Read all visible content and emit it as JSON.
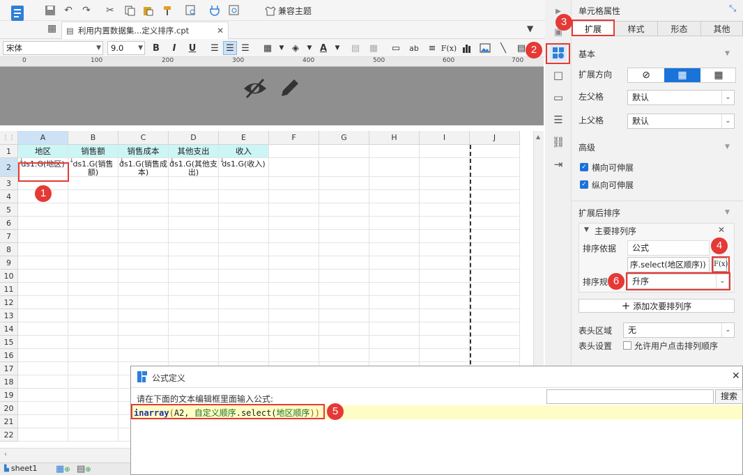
{
  "toolbar": {
    "theme_label": "兼容主题"
  },
  "file_tab": {
    "name": "利用内置数据集...定义排序.cpt"
  },
  "format_bar": {
    "font_name": "宋体",
    "font_size": "9.0",
    "fx_label": "F(x)",
    "ab_label": "ab"
  },
  "ruler": {
    "ticks": [
      "0",
      "100",
      "200",
      "300",
      "400",
      "500",
      "600",
      "700"
    ]
  },
  "grid": {
    "columns": [
      "A",
      "B",
      "C",
      "D",
      "E",
      "F",
      "G",
      "H",
      "I",
      "J"
    ],
    "rows": [
      "1",
      "2",
      "3",
      "4",
      "5",
      "6",
      "7",
      "8",
      "9",
      "10",
      "11",
      "12",
      "13",
      "14",
      "15",
      "16",
      "17",
      "18",
      "19",
      "20",
      "21",
      "22"
    ],
    "row1": [
      "地区",
      "销售额",
      "销售成本",
      "其他支出",
      "收入"
    ],
    "row2": [
      "ds1.G(地区)",
      "ds1.G(销售额)",
      "ds1.G(销售成本)",
      "ds1.G(其他支出)",
      "ds1.G(收入)"
    ]
  },
  "sheet": {
    "name": "sheet1"
  },
  "panel": {
    "title": "单元格属性",
    "tabs": [
      "扩展",
      "样式",
      "形态",
      "其他"
    ],
    "basic_section": "基本",
    "expand_direction_label": "扩展方向",
    "left_parent_label": "左父格",
    "left_parent_value": "默认",
    "top_parent_label": "上父格",
    "top_parent_value": "默认",
    "advanced_section": "高级",
    "h_expand_label": "横向可伸展",
    "v_expand_label": "纵向可伸展",
    "sort_section": "扩展后排序",
    "main_sort_label": "主要排列序",
    "sort_basis_label": "排序依据",
    "sort_basis_value": "公式",
    "sort_formula_value": "序.select(地区顺序))",
    "fx_button": "F(x)",
    "sort_rule_label": "排序规",
    "sort_rule_value": "升序",
    "add_sort_button": "添加次要排列序",
    "header_area_label": "表头区域",
    "header_area_value": "无",
    "header_settings_label": "表头设置",
    "allow_user_sort_label": "允许用户点击排列顺序"
  },
  "dialog": {
    "title": "公式定义",
    "prompt": "请在下面的文本编辑框里面输入公式:",
    "search_button": "搜索",
    "formula": {
      "fn": "inarray",
      "open": "(",
      "arg1": "A2, ",
      "arg2": "自定义顺序",
      "method": ".select(",
      "arg3": "地区顺序",
      "close": "))"
    }
  },
  "badges": [
    "1",
    "2",
    "3",
    "4",
    "5",
    "6"
  ],
  "colors": {
    "header_fill": "#ccf5f5",
    "badge_red": "#e53935",
    "active_blue": "#1a73d9",
    "formula_highlight": "#fdfdc5"
  }
}
